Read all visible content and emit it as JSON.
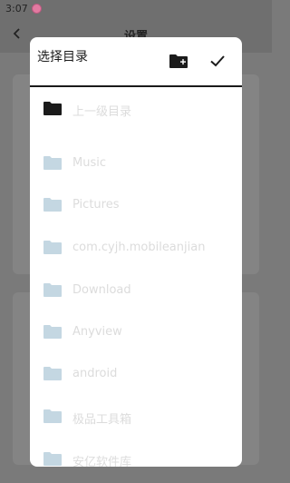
{
  "status_bar": {
    "time": "3:07"
  },
  "settings_page": {
    "title": "设置"
  },
  "dialog": {
    "title": "选择目录",
    "parent_dir_label": "上一级目录",
    "folders": [
      {
        "label": "Music"
      },
      {
        "label": "Pictures"
      },
      {
        "label": "com.cyjh.mobileanjian"
      },
      {
        "label": "Download"
      },
      {
        "label": "Anyview"
      },
      {
        "label": "android"
      },
      {
        "label": "极品工具箱"
      },
      {
        "label": "安亿软件库"
      }
    ]
  },
  "colors": {
    "dialog_background": "#ffffff",
    "parent_folder_icon": "#1b1b1b",
    "folder_icon": "#c4d7e2",
    "folder_label": "#dcdcdc",
    "scrim": "#7a7a7a"
  },
  "icons": [
    "pink-status-icon",
    "back-arrow-icon",
    "new-folder-icon",
    "checkmark-icon",
    "folder-icon"
  ]
}
